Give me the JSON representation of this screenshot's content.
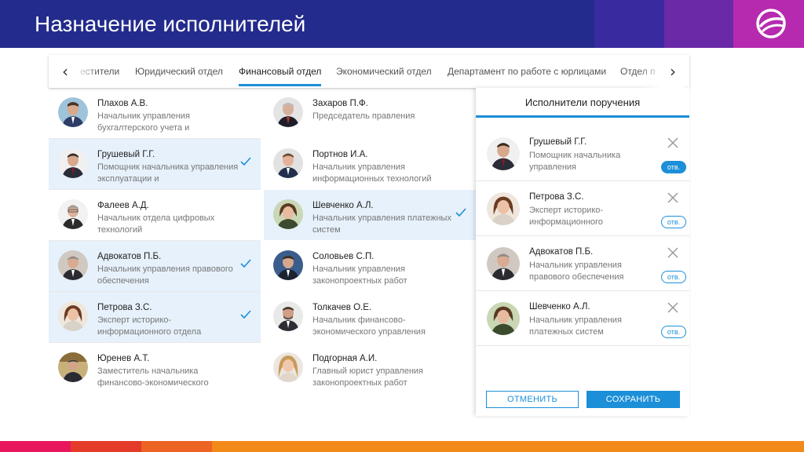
{
  "header": {
    "title": "Назначение исполнителей",
    "colors": {
      "main": "#232b8c",
      "accent1": "#3a2aa0",
      "accent2": "#6a2aa8",
      "accent3": "#b62ab0"
    }
  },
  "tabs": {
    "items": [
      {
        "label": "естители"
      },
      {
        "label": "Юридический отдел"
      },
      {
        "label": "Финансовый отдел",
        "active": true
      },
      {
        "label": "Экономический отдел"
      },
      {
        "label": "Департамент по работе с юрлицами"
      },
      {
        "label": "Отдел п"
      }
    ],
    "prev_icon": "‹",
    "next_icon": "›"
  },
  "people": [
    {
      "name": "Плахов А.В.",
      "job": "Начальник управления бухгалтерского учета и",
      "selected": false
    },
    {
      "name": "Захаров П.Ф.",
      "job": "Председатель правления",
      "selected": false
    },
    {
      "name": "Грушевый Г.Г.",
      "job": "Помощник начальника управления эксплуатации и",
      "selected": true
    },
    {
      "name": "Портнов И.А.",
      "job": "Начальник управления информационных технологий",
      "selected": false
    },
    {
      "name": "Фалеев А.Д.",
      "job": "Начальник отдела цифровых технологий",
      "selected": false
    },
    {
      "name": "Шевченко А.Л.",
      "job": "Начальник управления платежных систем",
      "selected": true
    },
    {
      "name": "Адвокатов П.Б.",
      "job": "Начальник управления правового обеспечения",
      "selected": true
    },
    {
      "name": "Соловьев С.П.",
      "job": "Начальник управления законопроектных работ",
      "selected": false
    },
    {
      "name": "Петрова З.С.",
      "job": "Эксперт историко-информационного отдела",
      "selected": true
    },
    {
      "name": "Толкачев О.Е.",
      "job": "Начальник финансово-экономического управления",
      "selected": false
    },
    {
      "name": "Юренев А.Т.",
      "job": "Заместитель начальника финансово-экономического",
      "selected": false
    },
    {
      "name": "Подгорная А.И.",
      "job": "Главный юрист управления законопроектных работ",
      "selected": false
    }
  ],
  "panel": {
    "title": "Исполнители поручения",
    "selected": [
      {
        "name": "Грушевый Г.Г.",
        "job": "Помощник начальника управления",
        "badge": "отв.",
        "badge_active": true
      },
      {
        "name": "Петрова З.С.",
        "job": "Эксперт историко-информационного",
        "badge": "отв.",
        "badge_active": false
      },
      {
        "name": "Адвокатов П.Б.",
        "job": "Начальник управления правового обеспечения",
        "badge": "отв.",
        "badge_active": false
      },
      {
        "name": "Шевченко А.Л.",
        "job": "Начальник управления платежных систем",
        "badge": "отв.",
        "badge_active": false
      }
    ],
    "cancel_label": "ОТМЕНИТЬ",
    "save_label": "СОХРАНИТЬ"
  },
  "colors": {
    "accent": "#1b8fd8",
    "selected_row": "#e6f1fb"
  }
}
